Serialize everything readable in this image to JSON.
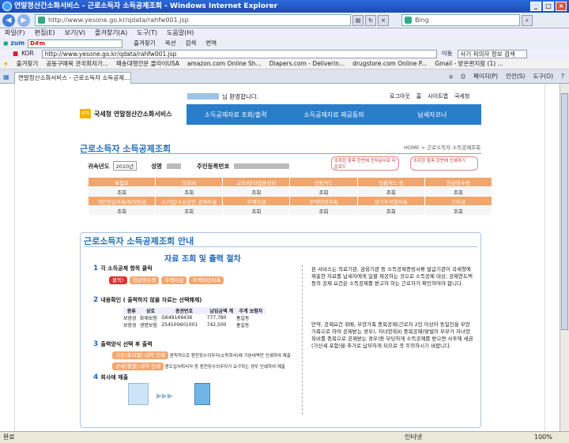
{
  "window": {
    "title": "연말정산간소화서비스 - 근로소득자 소득공제조회 - Windows Internet Explorer"
  },
  "address": {
    "url": "http://www.yesone.go.kr/qdata/rahfw001.jsp",
    "search_placeholder": "Bing"
  },
  "menu": [
    "파일(F)",
    "편집(E)",
    "보기(V)",
    "즐겨찾기(A)",
    "도구(T)",
    "도움말(H)"
  ],
  "toolbar1": {
    "logo": "zum",
    "search_value": "D#m",
    "items": [
      "즐겨찾기",
      "옥션",
      "검색",
      "번역"
    ]
  },
  "toolbar2": {
    "country": "KOR",
    "url": "http://www.yesone.go.kr/qdata/rahfw001.jsp",
    "go": "이동",
    "search_value": "사기 피의자 정보 검색"
  },
  "favorites": {
    "label": "즐겨찾기",
    "items": [
      "공동구매북 견국최저가...",
      "패송대행전문 클라이USA",
      "amazon.com Online Sh...",
      "Diapers.com - Deliverin...",
      "drugstore.com Online P...",
      "Gmail - 받은편지함 (1) ..."
    ]
  },
  "tab": {
    "label": "연말정산소화서비스 - 근로소득자 소득공제..."
  },
  "commands": [
    "페이지(P)",
    "안전(S)",
    "도구(O)"
  ],
  "page": {
    "welcome": "님 환영합니다.",
    "top_links": [
      "로그아웃",
      "홈",
      "사이트맵",
      "국세청"
    ],
    "logo_nts": "NTS",
    "logo_text": "국세청 연말정산간소화서비스",
    "nav": [
      "소득공제자료 조회/출력",
      "소득공제자료 제공동의",
      "납세자코너"
    ],
    "heading": "근로소득자 소득공제조회",
    "breadcrumb": "HOME > 근로소득자 소득공제조회",
    "filter": {
      "year_label": "귀속년도",
      "year_value": "2010년",
      "name_label": "성명",
      "id_label": "주민등록번호"
    },
    "print_btns": [
      "조회한 항목 한번에 전자문서로 다운로드",
      "조회한 항목 한번에 인쇄하기"
    ],
    "menu_headers1": [
      "보험료",
      "의료비",
      "교육비/직업훈련비",
      "신용카드",
      "직불카드 등",
      "현금영수증"
    ],
    "menu_headers2": [
      "개인연금저축/퇴직연금",
      "소기업/소상공인 공제부금",
      "주택자금",
      "주택마련저축",
      "장기주식형저축",
      "기부금"
    ],
    "menu_action": "조회",
    "guide_heading": "근로소득자 소득공제조회 안내",
    "guide_title": "자료 조회 및 출력 절차",
    "steps": [
      "각 소득공제 항목 클릭",
      "내용확인 ( 출력하지 않을 자료는 선택해제)",
      "출력양식 선택 후 출력",
      "회사에 제출"
    ],
    "step1_tabs": [
      "클릭!",
      "현금영수증",
      "주택자금",
      "주택마련저축"
    ],
    "table_headers": [
      "종류",
      "상호",
      "증권번호",
      "납입금액 계",
      "주계 보험자"
    ],
    "table_rows": [
      [
        "보장성",
        "화재보험",
        "G649149436",
        "777,780",
        "홍길동"
      ],
      [
        "보장성",
        "생명보험",
        "254500601001",
        "742,500",
        "홍길동"
      ]
    ],
    "print_options": [
      {
        "label": "기본(출처별) 내역 인쇄",
        "desc": "원칙적으로 원천징수의무자(소득회사)에 기본내역만 인쇄하여 제출"
      },
      {
        "label": "상세(월별) 내역 인쇄",
        "desc": "종도입사퇴사자 등 원천징수의무자가 요구하는 경우 인쇄하여 제출"
      }
    ],
    "notes": [
      "본 서비스는 의료기관, 금융기관 등 소득공제증빙서류 발급기관이 국세청에 제출한 자료를 납세자에게 일괄 제공하는 것으로 소득공제 대상, 공제한도액 등의 공제 요건은 소득공제를 받고자 하는 근로자가 확인하여야 합니다.",
      "만약, 공제요건 위배, 부양가족 중복공제(근로자 2인 이상이 동일인을 부양가족으로 하여 공제받는 경우), 자녀양육비 중복공제(맞벌이 부부가 자녀양육비를 중복으로 공제받는 경우)등 부당하게 소득공제를 받으면 사후에 세금(가산세 포함)을 추가로 납부하게 되므로 꼭 주의하시기 바랍니다."
    ]
  },
  "status": {
    "left": "완료",
    "zone": "인터넷",
    "zoom": "100%"
  },
  "colors": {
    "accent": "#1c66b5",
    "orange": "#f0a66d",
    "nav_bg": "#2a7ec9"
  }
}
